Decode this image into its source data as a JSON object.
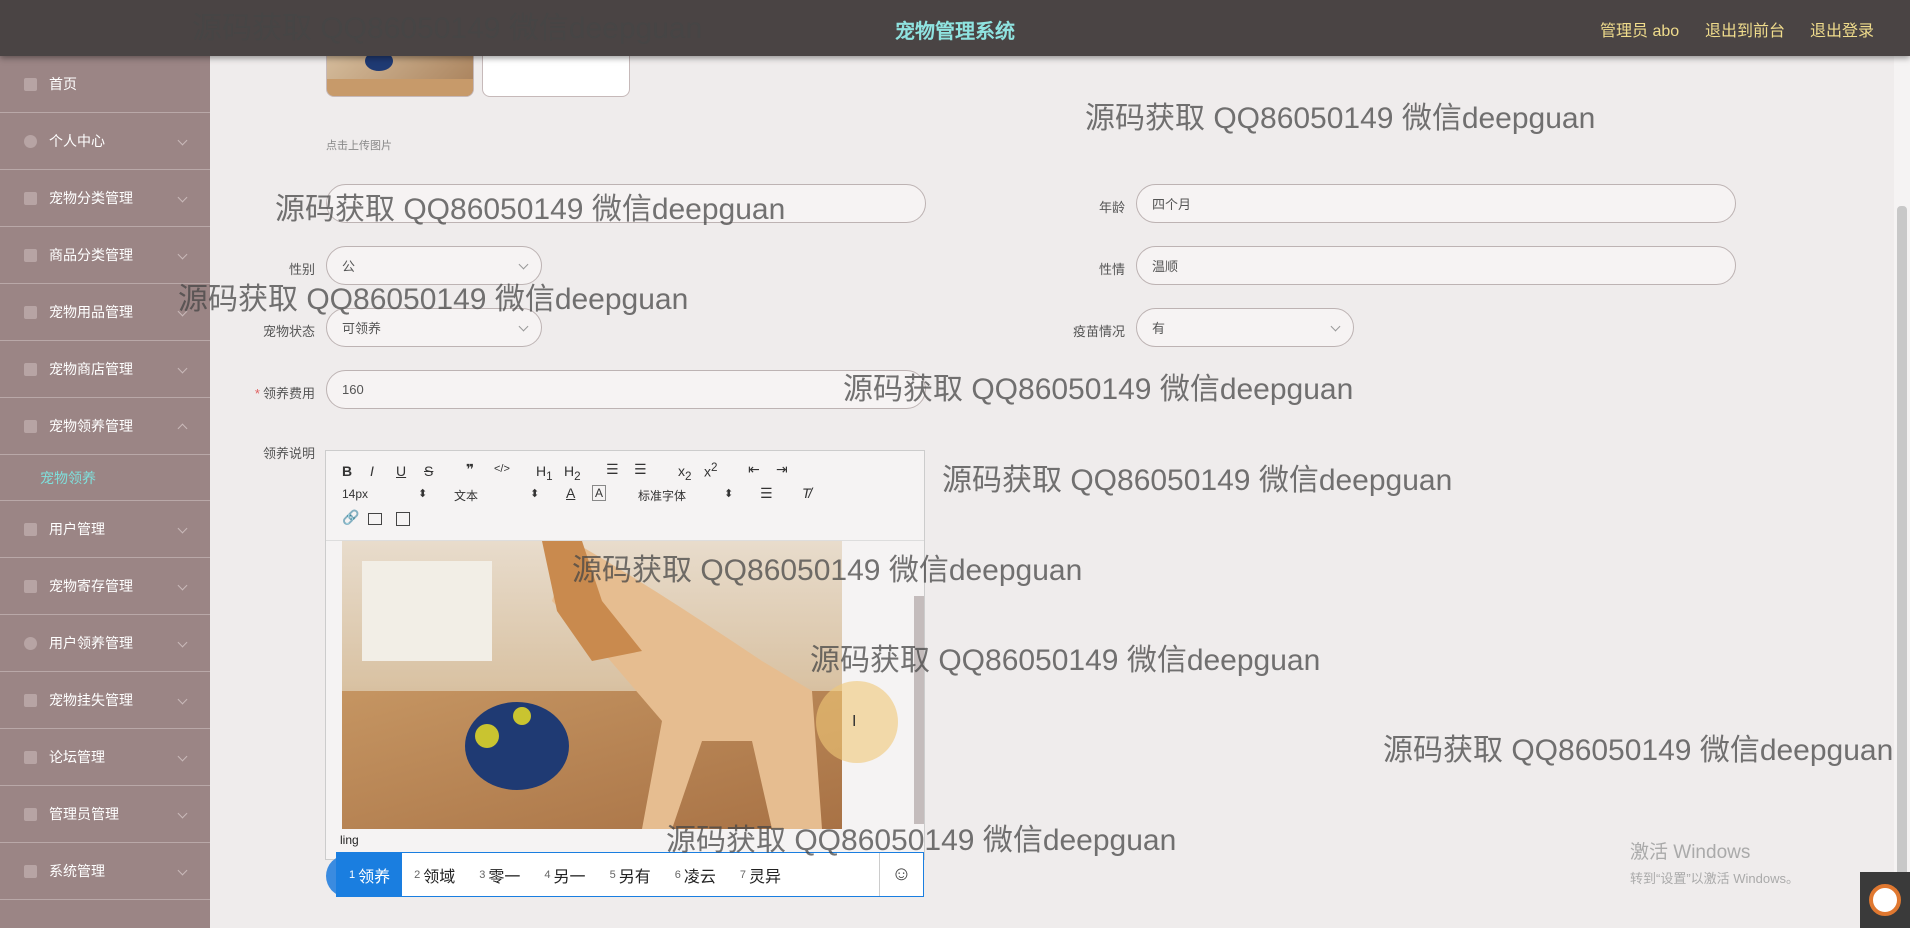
{
  "header": {
    "title": "宠物管理系统",
    "user": "管理员 abo",
    "front": "退出到前台",
    "logout": "退出登录"
  },
  "sidebar": {
    "items": [
      "首页",
      "个人中心",
      "宠物分类管理",
      "商品分类管理",
      "宠物用品管理",
      "宠物商店管理",
      "宠物领养管理"
    ],
    "sub": "宠物领养",
    "items2": [
      "用户管理",
      "宠物寄存管理",
      "用户领养管理",
      "宠物挂失管理",
      "论坛管理",
      "管理员管理",
      "系统管理"
    ]
  },
  "form": {
    "upload_hint": "点击上传图片",
    "age_label": "年龄",
    "age_value": "四个月",
    "gender_label": "性别",
    "gender_value": "公",
    "temper_label": "性情",
    "temper_value": "温顺",
    "status_label": "宠物状态",
    "status_value": "可领养",
    "vaccine_label": "疫苗情况",
    "vaccine_value": "有",
    "fee_label": "领养费用",
    "fee_value": "160",
    "desc_label": "领养说明"
  },
  "editor": {
    "font_size": "14px",
    "format": "文本",
    "font": "标准字体",
    "typed": "ling"
  },
  "ime": {
    "candidates": [
      {
        "n": "1",
        "t": "领养"
      },
      {
        "n": "2",
        "t": "领域"
      },
      {
        "n": "3",
        "t": "零一"
      },
      {
        "n": "4",
        "t": "另一"
      },
      {
        "n": "5",
        "t": "另有"
      },
      {
        "n": "6",
        "t": "凌云"
      },
      {
        "n": "7",
        "t": "灵异"
      }
    ],
    "emoji": "☺"
  },
  "activate": {
    "title": "激活 Windows",
    "sub": "转到“设置”以激活 Windows。"
  },
  "watermark": "源码获取 QQ86050149 微信deepguan",
  "colors": {
    "header": "#4a4444",
    "sidebar": "#9b8585",
    "accent": "#1a7ee0"
  }
}
